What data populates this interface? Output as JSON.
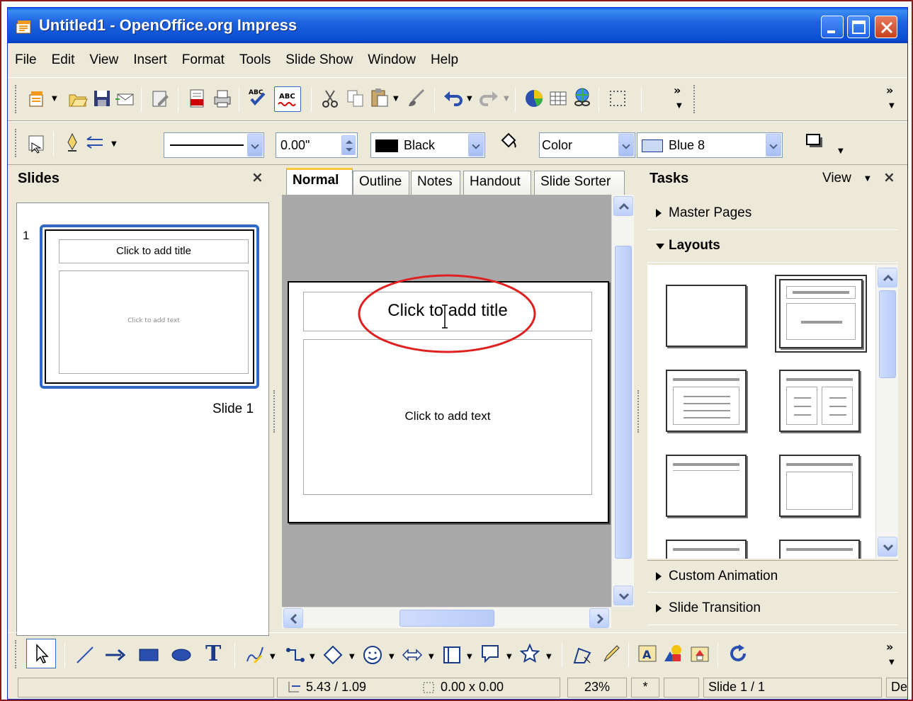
{
  "window": {
    "title": "Untitled1 - OpenOffice.org Impress"
  },
  "menu": [
    "File",
    "Edit",
    "View",
    "Insert",
    "Format",
    "Tools",
    "Slide Show",
    "Window",
    "Help"
  ],
  "toolbar2": {
    "line_width": "0.00\"",
    "line_color": "Black",
    "area_style": "Color",
    "area_color": "Blue 8"
  },
  "slides_pane": {
    "title": "Slides",
    "close": "×",
    "slide_number": "1",
    "thumb_title": "Click to add title",
    "thumb_text": "Click to add text",
    "slide_name": "Slide 1"
  },
  "view_tabs": [
    "Normal",
    "Outline",
    "Notes",
    "Handout",
    "Slide Sorter"
  ],
  "slide": {
    "title_placeholder": "Click to add title",
    "text_placeholder": "Click to add text"
  },
  "tasks_pane": {
    "title": "Tasks",
    "view_label": "View",
    "close": "×",
    "master_pages": "Master Pages",
    "layouts": "Layouts",
    "custom_animation": "Custom Animation",
    "slide_transition": "Slide Transition"
  },
  "status": {
    "position": "5.43 / 1.09",
    "size": "0.00 x 0.00",
    "zoom": "23%",
    "modified": "*",
    "slide": "Slide 1 / 1",
    "layout_name": "De"
  },
  "colors": {
    "titlebar": "#0a5ee8",
    "accent": "#316ac5",
    "annotation": "#e02020",
    "frame": "#8b1a1a"
  }
}
